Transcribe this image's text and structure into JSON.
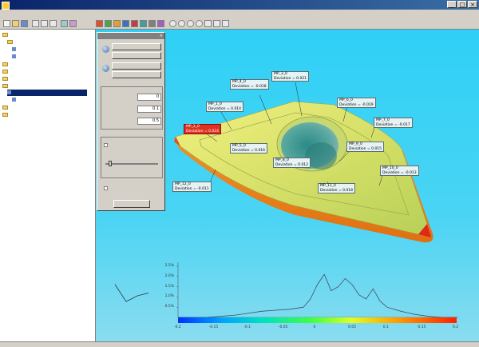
{
  "window": {
    "title": "",
    "controls": [
      "_",
      "□",
      "×"
    ]
  },
  "menu": [],
  "tree": {
    "items": [
      {
        "label": "",
        "kind": "folder",
        "level": 0
      },
      {
        "label": "",
        "kind": "folder",
        "level": 1
      },
      {
        "label": "",
        "kind": "leaf",
        "level": 2
      },
      {
        "label": "",
        "kind": "leaf",
        "level": 2
      },
      {
        "label": "",
        "kind": "folder",
        "level": 0
      },
      {
        "label": "",
        "kind": "folder",
        "level": 0
      },
      {
        "label": "",
        "kind": "folder",
        "level": 0
      },
      {
        "label": "",
        "kind": "folder",
        "level": 0
      },
      {
        "label": "",
        "kind": "leaf",
        "level": 1,
        "selected": true
      },
      {
        "label": "",
        "kind": "leaf",
        "level": 2
      },
      {
        "label": "",
        "kind": "folder",
        "level": 0
      },
      {
        "label": "",
        "kind": "folder",
        "level": 0
      }
    ]
  },
  "panel": {
    "title": "",
    "close": "×",
    "fields": [
      {
        "label": "",
        "value": "0"
      },
      {
        "label": "",
        "value": "0.1"
      },
      {
        "label": "",
        "value": "0.5"
      }
    ],
    "ok_label": ""
  },
  "callouts": [
    {
      "line1": "MP_4_0",
      "line2": "Deviation = -0.018",
      "red": false
    },
    {
      "line1": "MP_3_0",
      "line2": "Deviation = 0.021",
      "red": false
    },
    {
      "line1": "MP_1_0",
      "line2": "Deviation = 0.014",
      "red": false
    },
    {
      "line1": "MP_2_0",
      "line2": "Deviation = 0.024",
      "red": true
    },
    {
      "line1": "MP_5_0",
      "line2": "Deviation = 0.016",
      "red": false
    },
    {
      "line1": "MP_6_0",
      "line2": "Deviation = -0.019",
      "red": false
    },
    {
      "line1": "MP_7_0",
      "line2": "Deviation = -0.017",
      "red": false
    },
    {
      "line1": "MP_8_0",
      "line2": "Deviation = 0.012",
      "red": false
    },
    {
      "line1": "MP_9_0",
      "line2": "Deviation = 0.015",
      "red": false
    },
    {
      "line1": "MP_10_0",
      "line2": "Deviation = -0.013",
      "red": false
    },
    {
      "line1": "MP_11_0",
      "line2": "Deviation = 0.018",
      "red": false
    },
    {
      "line1": "MP_12_0",
      "line2": "Deviation = -0.011",
      "red": false
    }
  ],
  "chart_data": {
    "type": "line",
    "title": "",
    "xlabel": "",
    "ylabel": "",
    "y_ticks": [
      "2.5%",
      "2.0%",
      "1.5%",
      "1.0%",
      "0.5%"
    ],
    "ylim": [
      0,
      2.5
    ],
    "xlim": [
      -0.2,
      0.2
    ],
    "x": [
      -0.2,
      -0.18,
      -0.16,
      -0.14,
      -0.12,
      -0.1,
      -0.08,
      -0.06,
      -0.04,
      -0.02,
      -0.01,
      0.0,
      0.01,
      0.02,
      0.03,
      0.04,
      0.05,
      0.06,
      0.07,
      0.08,
      0.09,
      0.1,
      0.11,
      0.12,
      0.14,
      0.16,
      0.18,
      0.2
    ],
    "values": [
      0.0,
      0.0,
      0.0,
      0.05,
      0.1,
      0.2,
      0.3,
      0.35,
      0.4,
      0.5,
      0.9,
      1.6,
      2.1,
      1.3,
      1.5,
      1.9,
      1.6,
      1.1,
      0.9,
      1.4,
      0.8,
      0.5,
      0.4,
      0.3,
      0.15,
      0.05,
      0.0,
      0.0
    ],
    "colorbar_labels": [
      "-0.2",
      "-0.15",
      "-0.1",
      "-0.05",
      "0",
      "0.05",
      "0.1",
      "0.15",
      "0.2"
    ],
    "inset": {
      "x": [
        0,
        1,
        2,
        3
      ],
      "values": [
        2.2,
        0.4,
        1.0,
        1.3
      ]
    }
  }
}
